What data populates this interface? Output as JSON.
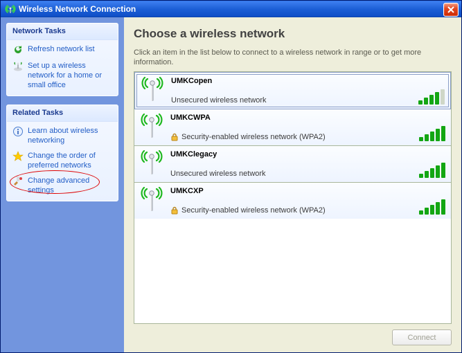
{
  "window": {
    "title": "Wireless Network Connection"
  },
  "sidebar": {
    "groups": [
      {
        "header": "Network Tasks",
        "items": [
          {
            "label": "Refresh network list"
          },
          {
            "label": "Set up a wireless network for a home or small office"
          }
        ]
      },
      {
        "header": "Related Tasks",
        "items": [
          {
            "label": "Learn about wireless networking"
          },
          {
            "label": "Change the order of preferred networks"
          },
          {
            "label": "Change advanced settings"
          }
        ]
      }
    ]
  },
  "main": {
    "title": "Choose a wireless network",
    "subtitle": "Click an item in the list below to connect to a wireless network in range or to get more information.",
    "connect_label": "Connect"
  },
  "networks": [
    {
      "ssid": "UMKCopen",
      "desc": "Unsecured wireless network",
      "secured": false,
      "bars": 4,
      "selected": true
    },
    {
      "ssid": "UMKCWPA",
      "desc": "Security-enabled wireless network (WPA2)",
      "secured": true,
      "bars": 5,
      "selected": false
    },
    {
      "ssid": "UMKClegacy",
      "desc": "Unsecured wireless network",
      "secured": false,
      "bars": 5,
      "selected": false
    },
    {
      "ssid": "UMKCXP",
      "desc": "Security-enabled wireless network (WPA2)",
      "secured": true,
      "bars": 5,
      "selected": false
    }
  ]
}
